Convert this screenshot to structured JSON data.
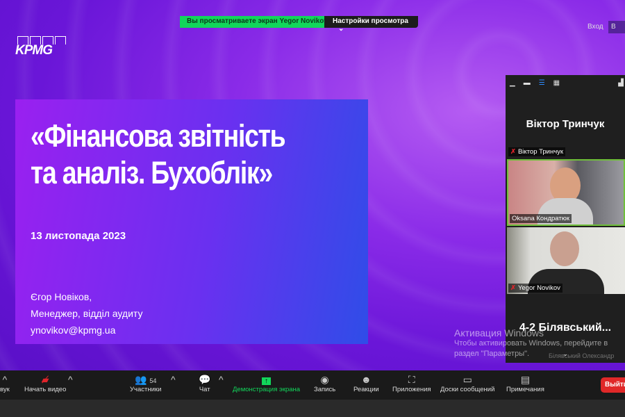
{
  "banner": {
    "viewing": "Вы просматриваете экран Yegor Novikov",
    "view_options": "Настройки просмотра",
    "login": "Вход",
    "b": "В"
  },
  "slide": {
    "logo": "KPMG",
    "title_line1": "«Фінансова звітність",
    "title_line2": "та аналіз. Бухоблік»",
    "date": "13 листопада 2023",
    "author_name": "Єгор Новіков,",
    "author_role": "Менеджер, відділ аудиту",
    "author_email": "ynovikov@kpmg.ua"
  },
  "panel": {
    "active_speaker": "Віктор Тринчук",
    "tiles": [
      {
        "name": "Віктор Тринчук",
        "muted": true
      },
      {
        "name": "Oksana Кондратюк",
        "muted": false
      },
      {
        "name": "Yegor Novikov",
        "muted": true
      }
    ],
    "next_name": "4-2 Білявський...",
    "next_sub": "Білявський Олександр"
  },
  "watermark": {
    "title": "Активация Windows",
    "line1": "Чтобы активировать Windows, перейдите в",
    "line2": "раздел \"Параметры\"."
  },
  "toolbar": {
    "audio": "вук",
    "video": "Начать видео",
    "participants": "Участники",
    "participants_count": "54",
    "chat": "Чат",
    "share": "Демонстрация экрана",
    "record": "Запись",
    "reactions": "Реакции",
    "apps": "Приложения",
    "whiteboards": "Доски сообщений",
    "notes": "Примечания",
    "leave": "Выйти"
  },
  "colors": {
    "share_green": "#12d65b",
    "leave_red": "#e02828",
    "slide_purple": "#8a2be8"
  }
}
